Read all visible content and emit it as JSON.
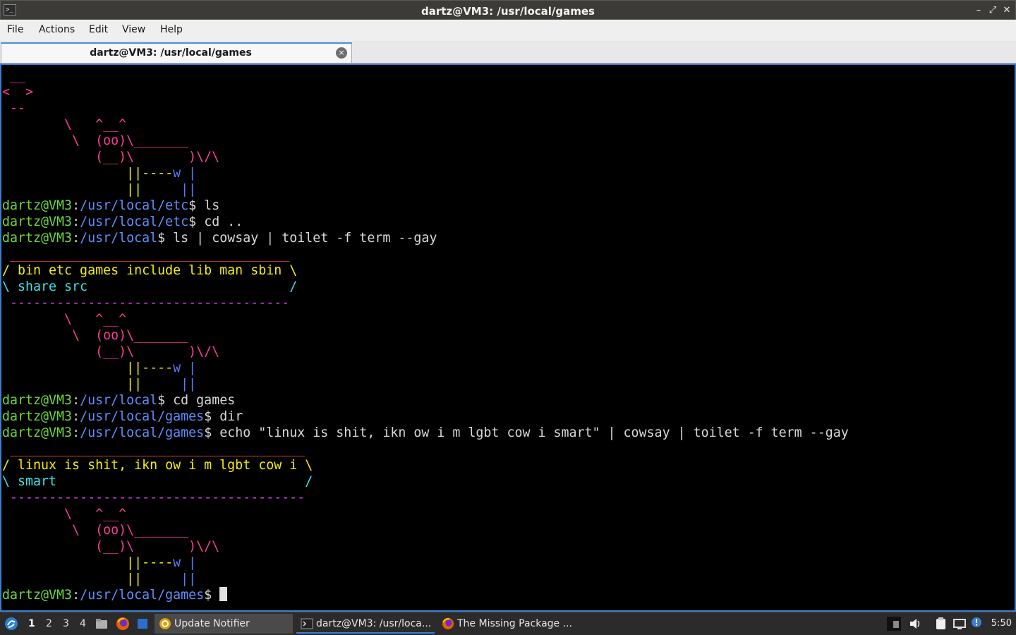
{
  "window": {
    "title": "dartz@VM3: /usr/local/games",
    "app_icon": ">_"
  },
  "window_buttons": {
    "minimize": "–",
    "maximize": "⤢",
    "close": "✕"
  },
  "menu": [
    "File",
    "Actions",
    "Edit",
    "View",
    "Help"
  ],
  "tab": {
    "label": "dartz@VM3: /usr/local/games",
    "close_icon": "×"
  },
  "terminal": {
    "prompt_user": "dartz@VM3",
    "commands": [
      {
        "path": "/usr/local/etc",
        "cmd": " ls"
      },
      {
        "path": "/usr/local/etc",
        "cmd": " cd .."
      },
      {
        "path": "/usr/local",
        "cmd": " ls | cowsay | toilet -f term --gay"
      },
      {
        "path": "/usr/local",
        "cmd": " cd games"
      },
      {
        "path": "/usr/local/games",
        "cmd": " dir"
      },
      {
        "path": "/usr/local/games",
        "cmd": " echo \"linux is shit, ikn ow i m lgbt cow i smart\" | cowsay | toilet -f term --gay"
      },
      {
        "path": "/usr/local/games",
        "cmd": " "
      }
    ],
    "bubble1": {
      "line1": "/ bin etc games include lib man sbin \\",
      "line2": "\\ share src                          /"
    },
    "bubble2": {
      "line1": "/ linux is shit, ikn ow i m lgbt cow i \\",
      "line2": "\\ smart                                /"
    }
  },
  "taskbar": {
    "workspaces": [
      "1",
      "2",
      "3",
      "4"
    ],
    "tasks": [
      {
        "label": "Update Notifier",
        "icon": "update-notifier-icon"
      },
      {
        "label": "dartz@VM3: /usr/loca...",
        "icon": "terminal-icon"
      },
      {
        "label": "The Missing Package ...",
        "icon": "firefox-icon"
      }
    ],
    "clock": "5:50"
  },
  "colors": {
    "accent": "#3a7fd0",
    "prompt_user": "#70d63c",
    "prompt_path": "#5f8fff"
  }
}
